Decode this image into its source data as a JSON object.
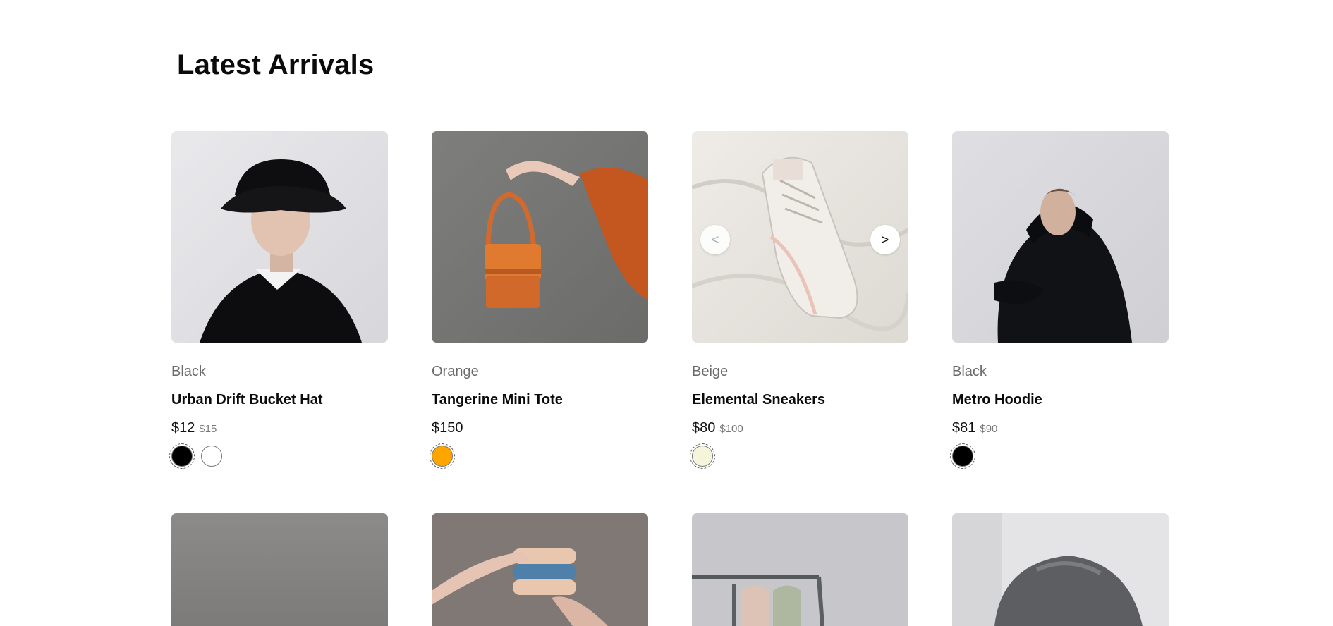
{
  "section": {
    "title": "Latest Arrivals"
  },
  "products": [
    {
      "color_name": "Black",
      "title": "Urban Drift Bucket Hat",
      "price": "$12",
      "old_price": "$15",
      "swatches": [
        "#000000",
        "#ffffff"
      ]
    },
    {
      "color_name": "Orange",
      "title": "Tangerine Mini Tote",
      "price": "$150",
      "old_price": "",
      "swatches": [
        "#ffa500"
      ]
    },
    {
      "color_name": "Beige",
      "title": "Elemental Sneakers",
      "price": "$80",
      "old_price": "$100",
      "swatches": [
        "#f5f5dc"
      ]
    },
    {
      "color_name": "Black",
      "title": "Metro Hoodie",
      "price": "$81",
      "old_price": "$90",
      "swatches": [
        "#000000"
      ]
    }
  ],
  "carousel": {
    "prev_label": "<",
    "next_label": ">"
  },
  "icons": [
    "chevron-left-icon",
    "chevron-right-icon"
  ]
}
